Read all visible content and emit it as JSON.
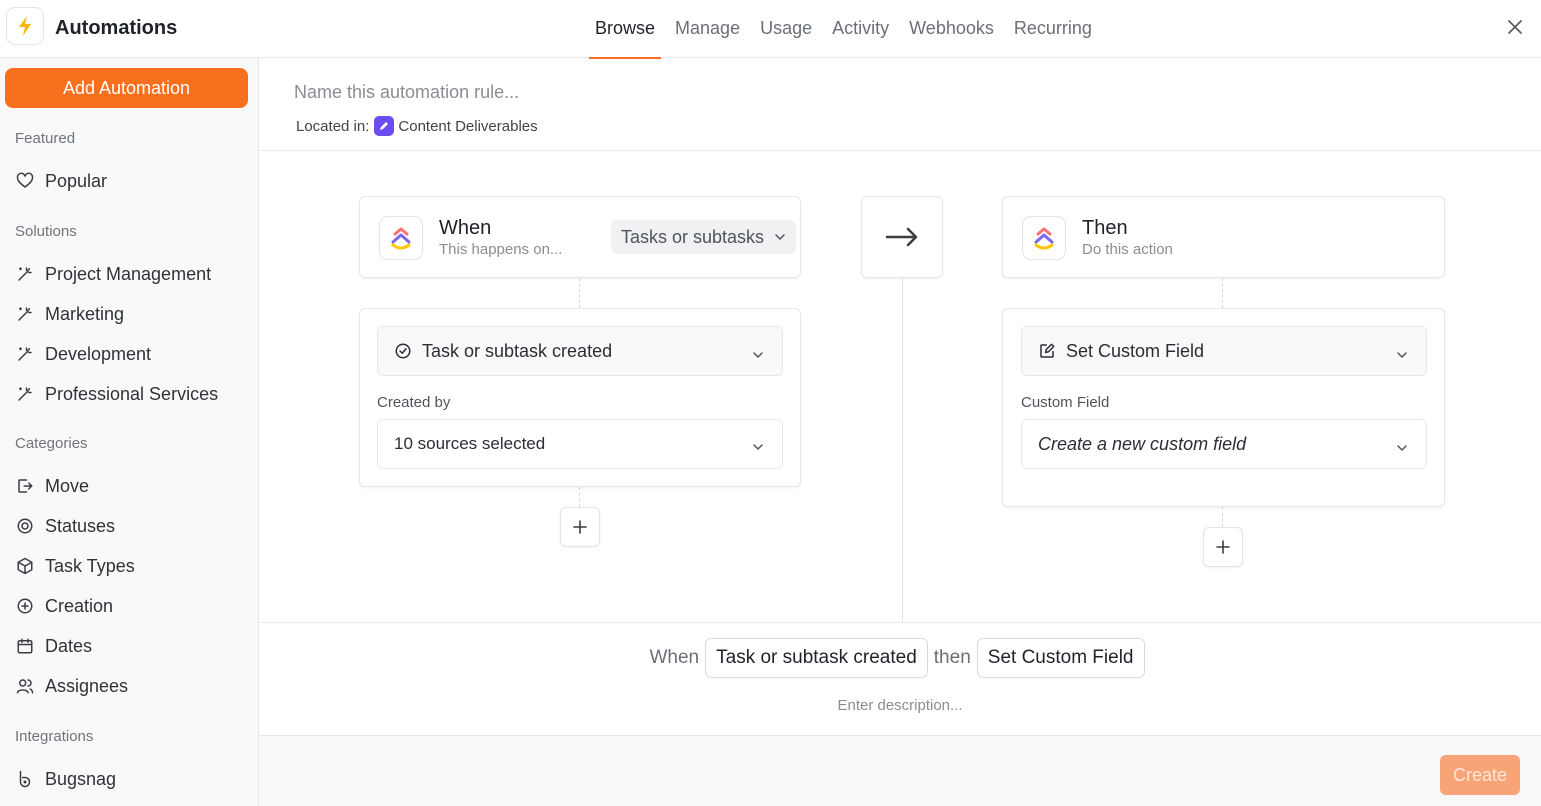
{
  "header": {
    "title": "Automations",
    "tabs": [
      {
        "label": "Browse",
        "active": true
      },
      {
        "label": "Manage"
      },
      {
        "label": "Usage"
      },
      {
        "label": "Activity"
      },
      {
        "label": "Webhooks"
      },
      {
        "label": "Recurring"
      }
    ],
    "accent_color": "#f37021"
  },
  "sidebar": {
    "add_button": "Add Automation",
    "featured_title": "Featured",
    "featured": [
      {
        "label": "Popular",
        "icon": "heart-icon"
      }
    ],
    "solutions_title": "Solutions",
    "solutions": [
      {
        "label": "Project Management",
        "icon": "magic-wand-icon"
      },
      {
        "label": "Marketing",
        "icon": "magic-wand-icon"
      },
      {
        "label": "Development",
        "icon": "magic-wand-icon"
      },
      {
        "label": "Professional Services",
        "icon": "magic-wand-icon"
      }
    ],
    "categories_title": "Categories",
    "categories": [
      {
        "label": "Move",
        "icon": "move-icon"
      },
      {
        "label": "Statuses",
        "icon": "status-icon"
      },
      {
        "label": "Task Types",
        "icon": "cube-icon"
      },
      {
        "label": "Creation",
        "icon": "plus-circle-icon"
      },
      {
        "label": "Dates",
        "icon": "calendar-icon"
      },
      {
        "label": "Assignees",
        "icon": "users-icon"
      }
    ],
    "integrations_title": "Integrations",
    "integrations": [
      {
        "label": "Bugsnag",
        "icon": "bugsnag-icon"
      }
    ]
  },
  "rule": {
    "name_placeholder": "Name this automation rule...",
    "located_label": "Located in:",
    "location": "Content Deliverables"
  },
  "trigger": {
    "title": "When",
    "subtitle": "This happens on...",
    "scope": "Tasks or subtasks",
    "event": "Task or subtask created",
    "field_label": "Created by",
    "field_value": "10 sources selected"
  },
  "action": {
    "title": "Then",
    "subtitle": "Do this action",
    "event": "Set Custom Field",
    "field_label": "Custom Field",
    "field_value": "Create a new custom field"
  },
  "summary": {
    "when": "When",
    "trigger": "Task or subtask created",
    "then": "then",
    "action": "Set Custom Field",
    "description_placeholder": "Enter description..."
  },
  "footer": {
    "create": "Create"
  }
}
